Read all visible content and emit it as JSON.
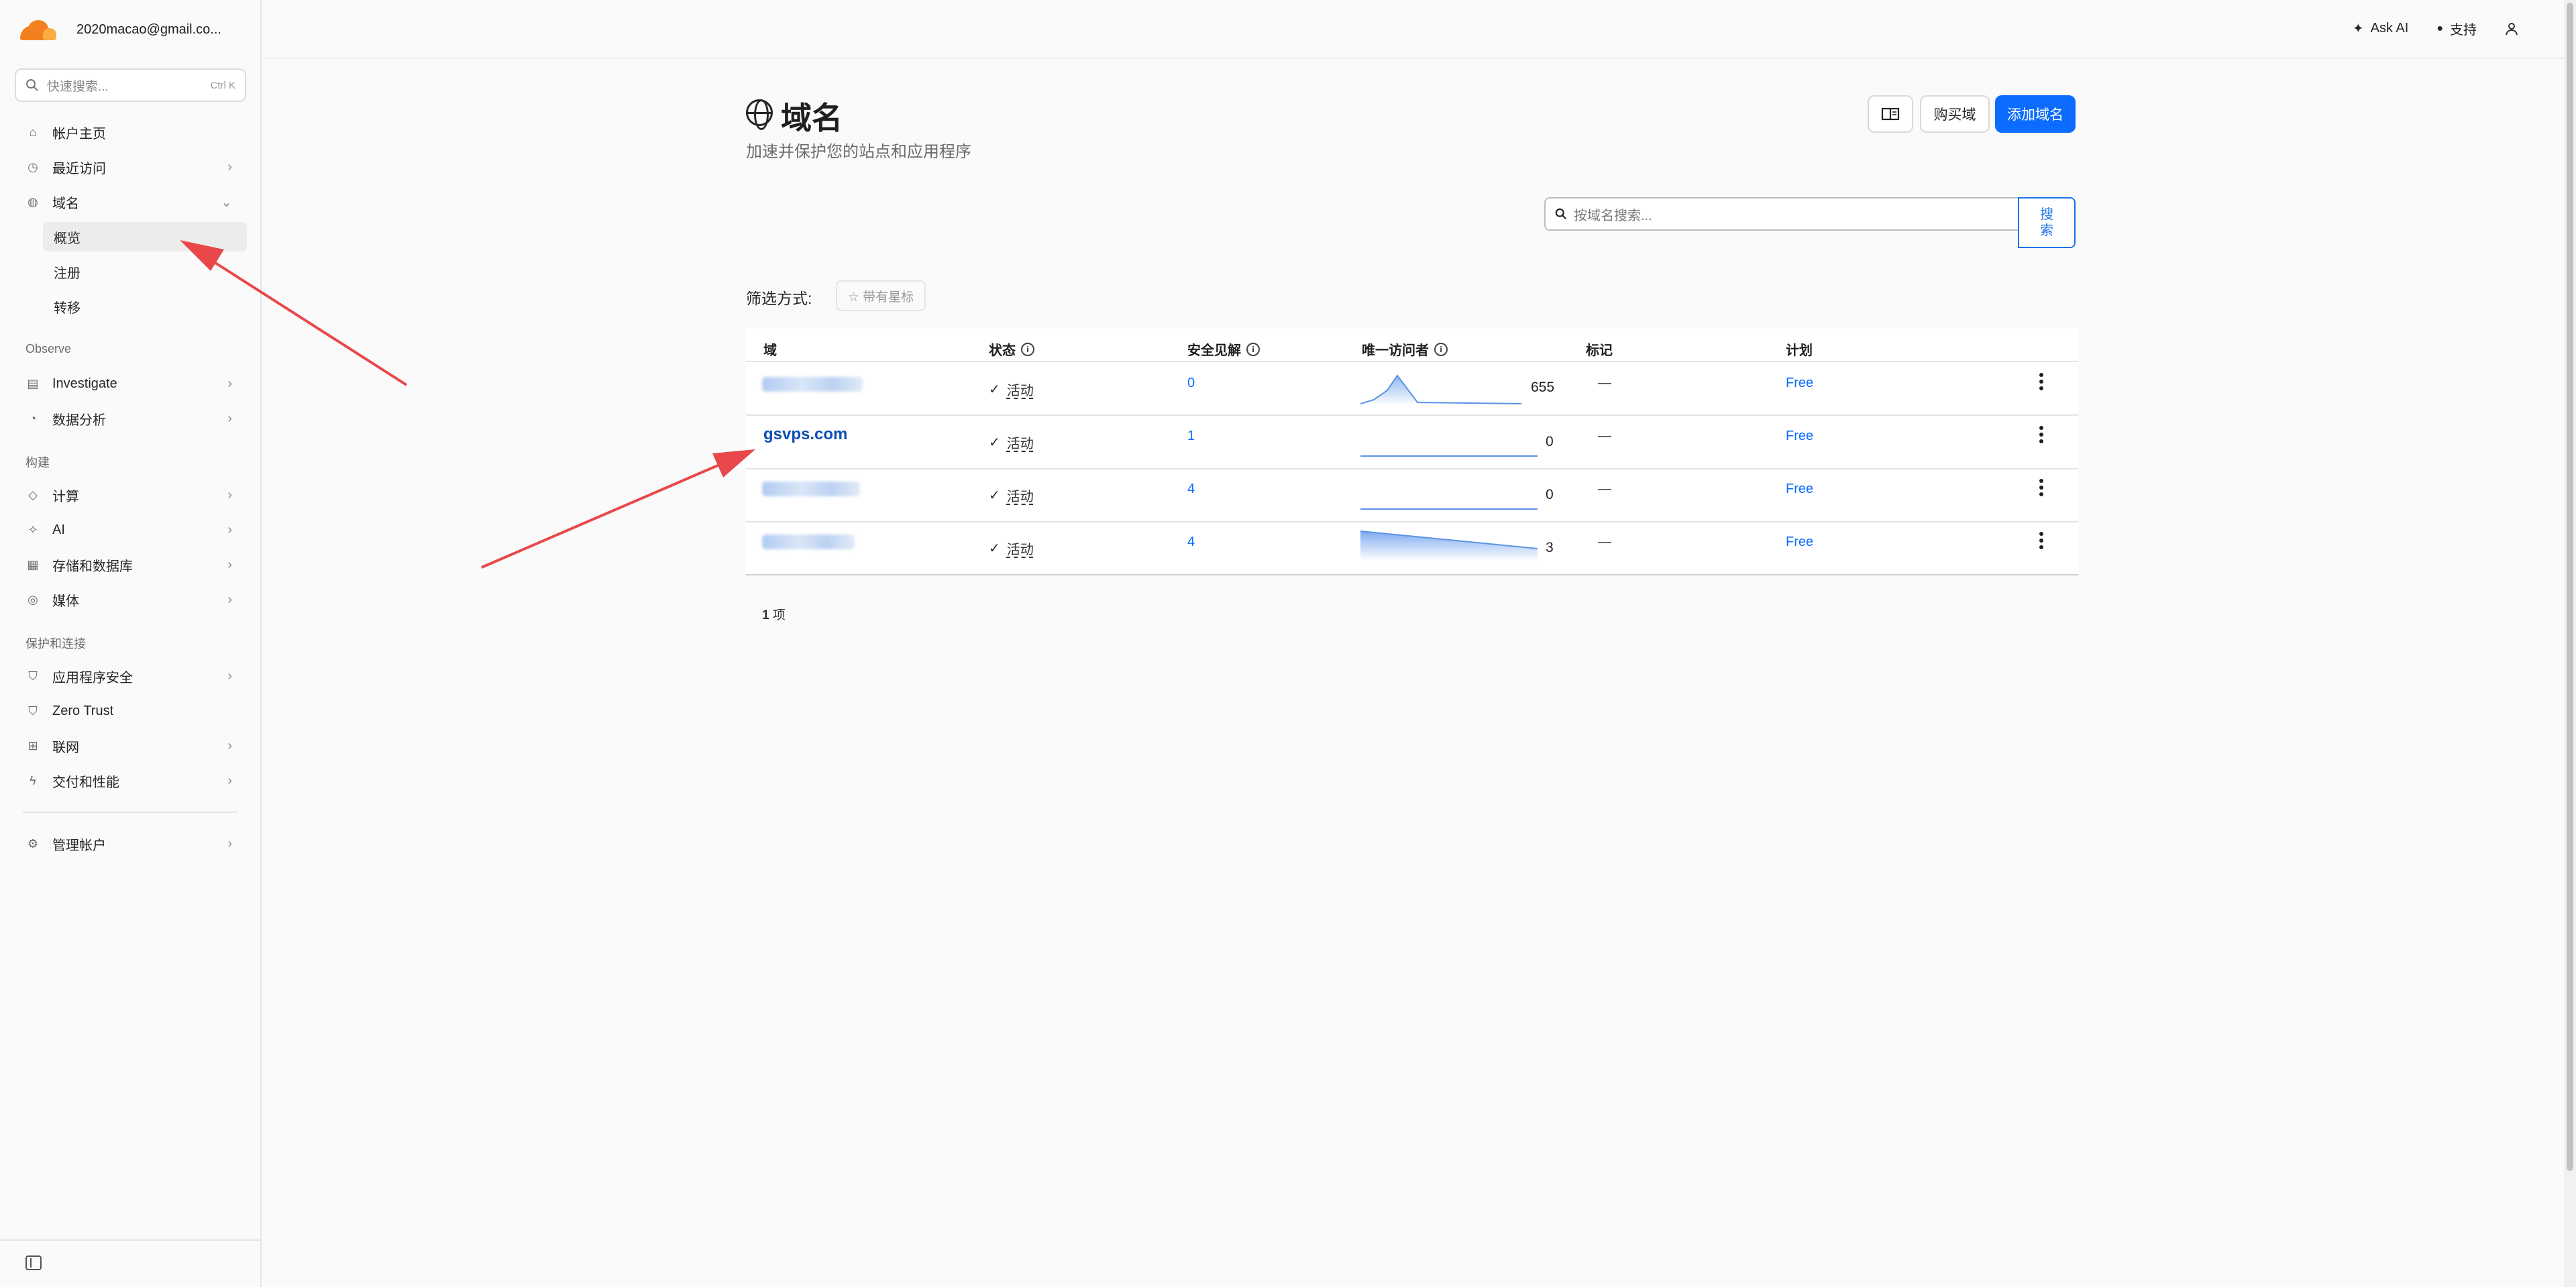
{
  "account": {
    "email": "2020macao@gmail.co..."
  },
  "sidebar": {
    "search": {
      "placeholder": "快速搜索...",
      "shortcut": "Ctrl K"
    },
    "items": [
      {
        "label": "帐户主页",
        "icon": "home-icon"
      },
      {
        "label": "最近访问",
        "icon": "clock-icon",
        "chevron": "›"
      },
      {
        "label": "域名",
        "icon": "globe-icon",
        "chevron": "⌄"
      },
      {
        "label": "Investigate",
        "icon": "investigate-icon",
        "chevron": "›"
      },
      {
        "label": "数据分析",
        "icon": "analytics-icon",
        "chevron": "›"
      },
      {
        "label": "计算",
        "icon": "compute-icon",
        "chevron": "›"
      },
      {
        "label": "AI",
        "icon": "ai-icon",
        "chevron": "›"
      },
      {
        "label": "存储和数据库",
        "icon": "storage-icon",
        "chevron": "›"
      },
      {
        "label": "媒体",
        "icon": "media-icon",
        "chevron": "›"
      },
      {
        "label": "应用程序安全",
        "icon": "shield-icon",
        "chevron": "›"
      },
      {
        "label": "Zero Trust",
        "icon": "zero-trust-icon"
      },
      {
        "label": "联网",
        "icon": "network-icon",
        "chevron": "›"
      },
      {
        "label": "交付和性能",
        "icon": "bolt-icon",
        "chevron": "›"
      },
      {
        "label": "管理帐户",
        "icon": "gear-icon",
        "chevron": "›"
      }
    ],
    "sub_items": [
      {
        "label": "概览"
      },
      {
        "label": "注册"
      },
      {
        "label": "转移"
      }
    ],
    "sections": {
      "observe": "Observe",
      "build": "构建",
      "protect": "保护和连接"
    }
  },
  "topbar": {
    "ask_ai": "Ask AI",
    "support": "支持"
  },
  "page": {
    "title": "域名",
    "subtitle": "加速并保护您的站点和应用程序",
    "buy_label": "购买域",
    "add_label": "添加域名",
    "search_placeholder": "按域名搜索...",
    "search_button": "搜索",
    "filter_label": "筛选方式:",
    "starred_label": "☆ 带有星标",
    "total_count": "1",
    "total_unit": " 项"
  },
  "table": {
    "headers": {
      "domain": "域",
      "status": "状态",
      "insights": "安全见解",
      "visitors": "唯一访问者",
      "mark": "标记",
      "plan": "计划"
    },
    "rows": [
      {
        "domain": "",
        "status": "活动",
        "insights": "0",
        "visitors": "655",
        "mark": "—",
        "plan": "Free"
      },
      {
        "domain": "gsvps.com",
        "status": "活动",
        "insights": "1",
        "visitors": "0",
        "mark": "—",
        "plan": "Free"
      },
      {
        "domain": "",
        "status": "活动",
        "insights": "4",
        "visitors": "0",
        "mark": "—",
        "plan": "Free"
      },
      {
        "domain": "",
        "status": "活动",
        "insights": "4",
        "visitors": "3",
        "mark": "—",
        "plan": "Free"
      }
    ]
  },
  "colors": {
    "accent": "#0b6cff",
    "brand": "#f38020",
    "arrow": "#e8484a"
  }
}
